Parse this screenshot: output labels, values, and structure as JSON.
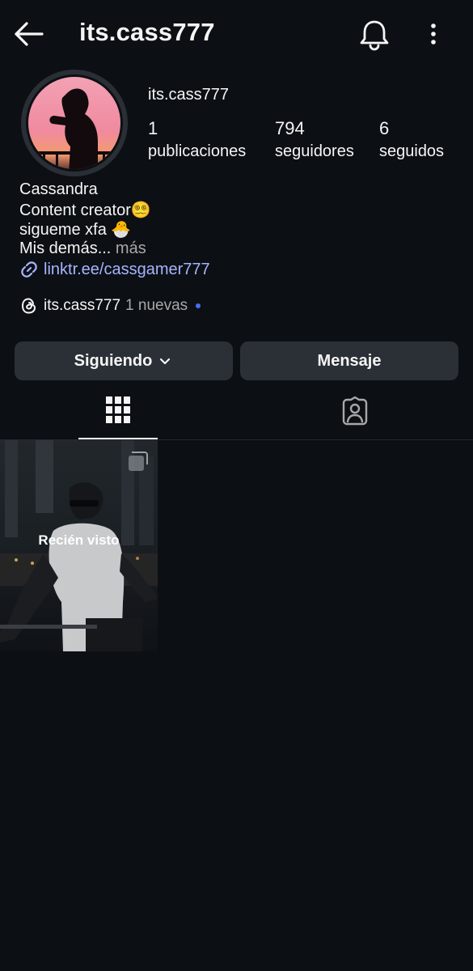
{
  "header": {
    "title": "its.cass777"
  },
  "profile": {
    "username": "its.cass777",
    "stats": [
      {
        "value": "1",
        "label": "publicaciones"
      },
      {
        "value": "794",
        "label": "seguidores"
      },
      {
        "value": "6",
        "label": "seguidos"
      }
    ],
    "bio": {
      "name": "Cassandra",
      "line1": "Content creator😵‍💫",
      "line2": "sigueme xfa 🐣",
      "line3": "Mis demás...",
      "more": "más",
      "link": "linktr.ee/cassgamer777"
    },
    "threads": {
      "handle": "its.cass777",
      "badge": "1 nuevas"
    }
  },
  "buttons": {
    "following": "Siguiendo",
    "message": "Mensaje"
  },
  "tabs": [
    {
      "icon": "grid-icon",
      "active": true
    },
    {
      "icon": "tagged-icon",
      "active": false
    }
  ],
  "posts": [
    {
      "label": "Recién visto"
    }
  ],
  "colors": {
    "background": "#0c1014",
    "button": "#2b3036",
    "link": "#a7b4ff",
    "dot": "#4a6cf7"
  }
}
